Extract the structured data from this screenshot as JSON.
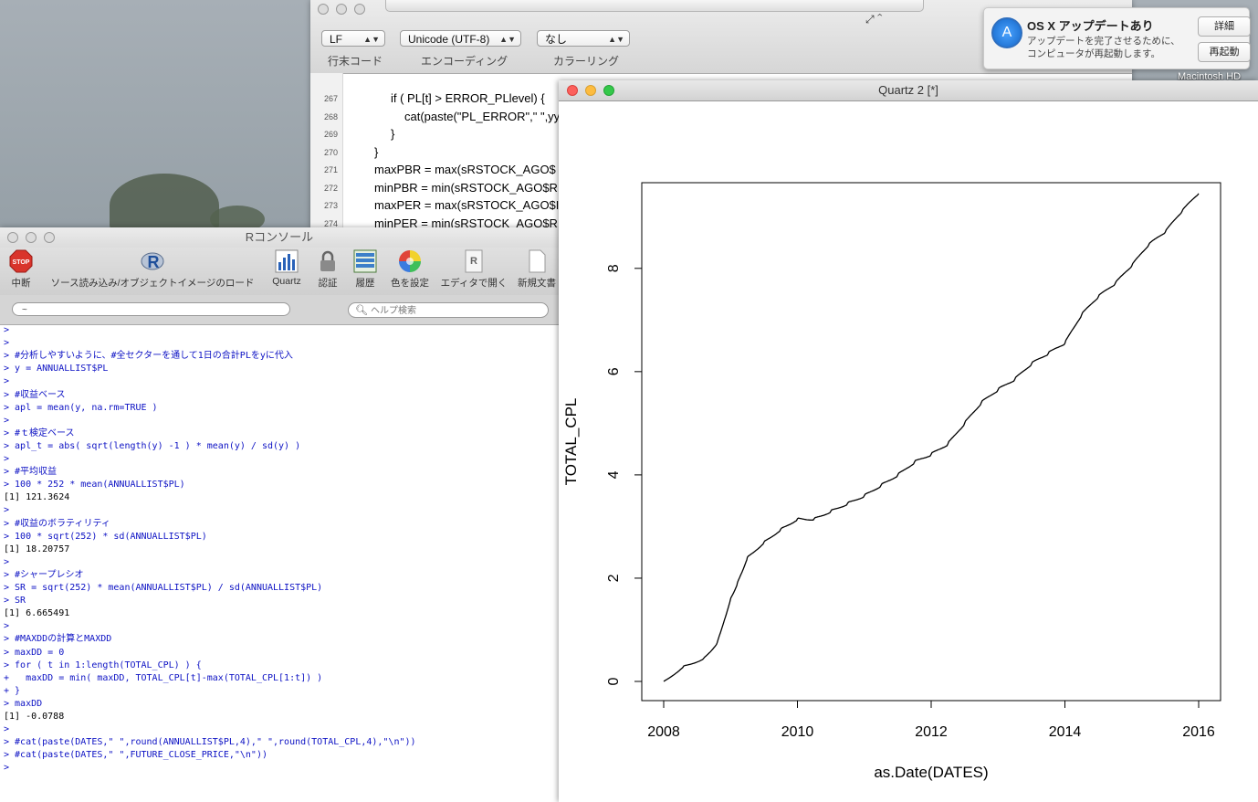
{
  "editor": {
    "line_ending": "LF",
    "encoding": "Unicode (UTF-8)",
    "coloring": "なし",
    "caption_line_ending": "行末コード",
    "caption_encoding": "エンコーディング",
    "caption_coloring": "カラーリング",
    "lines": [
      {
        "num": "267",
        "text": "if ( PL[t] > ERROR_PLlevel) {"
      },
      {
        "num": "268",
        "text": "cat(paste(\"PL_ERROR\",\" \",yy"
      },
      {
        "num": "269",
        "text": "}"
      },
      {
        "num": "270",
        "text": "}"
      },
      {
        "num": "271",
        "text": "maxPBR = max(sRSTOCK_AGO$"
      },
      {
        "num": "272",
        "text": "minPBR = min(sRSTOCK_AGO$R"
      },
      {
        "num": "273",
        "text": "maxPER = max(sRSTOCK_AGO$I"
      },
      {
        "num": "274",
        "text": "minPER = min(sRSTOCK_AGO$R"
      }
    ]
  },
  "notification": {
    "title": "OS X アップデートあり",
    "body_line1": "アップデートを完了させるために、",
    "body_line2": "コンピュータが再起動します。",
    "details_button": "詳細",
    "restart_button": "再起動"
  },
  "desktop": {
    "disk_label": "Macintosh HD"
  },
  "console": {
    "title": "Rコンソール",
    "toolbar": [
      {
        "label": "中断",
        "icon": "stop-icon"
      },
      {
        "label": "ソース読み込み/オブジェクトイメージのロード",
        "icon": "r-logo-icon"
      },
      {
        "label": "Quartz",
        "icon": "quartz-chart-icon"
      },
      {
        "label": "認証",
        "icon": "lock-icon"
      },
      {
        "label": "履歴",
        "icon": "history-icon"
      },
      {
        "label": "色を設定",
        "icon": "color-wheel-icon"
      },
      {
        "label": "エディタで開く",
        "icon": "open-editor-icon"
      },
      {
        "label": "新規文書",
        "icon": "new-document-icon"
      }
    ],
    "path": "~",
    "help_placeholder": "ヘルプ検索",
    "lines": [
      {
        "t": "p",
        "text": ">"
      },
      {
        "t": "p",
        "text": ">"
      },
      {
        "t": "p",
        "text": "> #分析しやすいように、#全セクターを通して1日の合計PLをyに代入"
      },
      {
        "t": "p",
        "text": "> y = ANNUALLIST$PL"
      },
      {
        "t": "p",
        "text": ">"
      },
      {
        "t": "p",
        "text": "> #収益ベース"
      },
      {
        "t": "p",
        "text": "> apl = mean(y, na.rm=TRUE )"
      },
      {
        "t": "p",
        "text": ">"
      },
      {
        "t": "p",
        "text": "> #ｔ検定ベース"
      },
      {
        "t": "p",
        "text": "> apl_t = abs( sqrt(length(y) -1 ) * mean(y) / sd(y) )"
      },
      {
        "t": "p",
        "text": ">"
      },
      {
        "t": "p",
        "text": "> #平均収益"
      },
      {
        "t": "p",
        "text": "> 100 * 252 * mean(ANNUALLIST$PL)"
      },
      {
        "t": "o",
        "text": "[1] 121.3624"
      },
      {
        "t": "p",
        "text": ">"
      },
      {
        "t": "p",
        "text": "> #収益のボラティリティ"
      },
      {
        "t": "p",
        "text": "> 100 * sqrt(252) * sd(ANNUALLIST$PL)"
      },
      {
        "t": "o",
        "text": "[1] 18.20757"
      },
      {
        "t": "p",
        "text": ">"
      },
      {
        "t": "p",
        "text": "> #シャープレシオ"
      },
      {
        "t": "p",
        "text": "> SR = sqrt(252) * mean(ANNUALLIST$PL) / sd(ANNUALLIST$PL)"
      },
      {
        "t": "p",
        "text": "> SR"
      },
      {
        "t": "o",
        "text": "[1] 6.665491"
      },
      {
        "t": "p",
        "text": ">"
      },
      {
        "t": "p",
        "text": "> #MAXDDの計算とMAXDD"
      },
      {
        "t": "p",
        "text": "> maxDD = 0"
      },
      {
        "t": "p",
        "text": "> for ( t in 1:length(TOTAL_CPL) ) {"
      },
      {
        "t": "p",
        "text": "+   maxDD = min( maxDD, TOTAL_CPL[t]-max(TOTAL_CPL[1:t]) )"
      },
      {
        "t": "p",
        "text": "+ }"
      },
      {
        "t": "p",
        "text": "> maxDD"
      },
      {
        "t": "o",
        "text": "[1] -0.0788"
      },
      {
        "t": "p",
        "text": ">"
      },
      {
        "t": "p",
        "text": "> #cat(paste(DATES,\" \",round(ANNUALLIST$PL,4),\" \",round(TOTAL_CPL,4),\"\\n\"))"
      },
      {
        "t": "p",
        "text": "> #cat(paste(DATES,\" \",FUTURE_CLOSE_PRICE,\"\\n\"))"
      },
      {
        "t": "p",
        "text": ">"
      }
    ]
  },
  "quartz": {
    "title": "Quartz 2 [*]"
  },
  "chart_data": {
    "type": "line",
    "title": "",
    "xlabel": "as.Date(DATES)",
    "ylabel": "TOTAL_CPL",
    "xlim": [
      2008,
      2016
    ],
    "ylim": [
      0,
      9.5
    ],
    "xticks": [
      "2008",
      "2010",
      "2012",
      "2014",
      "2016"
    ],
    "yticks": [
      "0",
      "2",
      "4",
      "6",
      "8"
    ],
    "series": [
      {
        "x": [
          2008.0,
          2008.3,
          2008.6,
          2008.8,
          2009.0,
          2009.1,
          2009.25,
          2009.5,
          2009.75,
          2010.0,
          2010.25,
          2010.5,
          2010.75,
          2011.0,
          2011.25,
          2011.5,
          2011.75,
          2012.0,
          2012.25,
          2012.5,
          2012.75,
          2013.0,
          2013.25,
          2013.5,
          2013.75,
          2014.0,
          2014.25,
          2014.5,
          2014.75,
          2015.0,
          2015.25,
          2015.5,
          2015.75,
          2016.0
        ],
        "values": [
          0.0,
          0.3,
          0.45,
          0.75,
          1.6,
          1.9,
          2.4,
          2.7,
          2.95,
          3.15,
          3.15,
          3.3,
          3.45,
          3.6,
          3.8,
          4.0,
          4.25,
          4.4,
          4.6,
          5.0,
          5.4,
          5.65,
          5.85,
          6.15,
          6.35,
          6.55,
          7.1,
          7.45,
          7.7,
          8.05,
          8.45,
          8.7,
          9.1,
          9.45
        ]
      }
    ]
  }
}
